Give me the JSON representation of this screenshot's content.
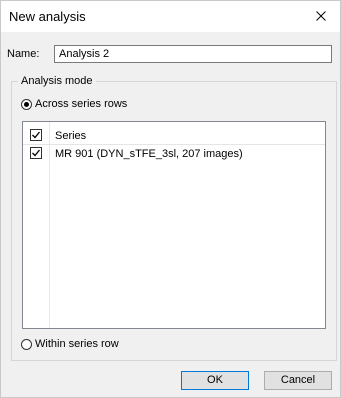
{
  "window": {
    "title": "New analysis"
  },
  "name_field": {
    "label": "Name:",
    "value": "Analysis 2"
  },
  "analysis_mode": {
    "legend": "Analysis mode",
    "options": [
      {
        "label": "Across series rows",
        "selected": true
      },
      {
        "label": "Within series row",
        "selected": false
      }
    ]
  },
  "series_list": {
    "header": {
      "label": "Series",
      "checked": true
    },
    "items": [
      {
        "label": "MR 901 (DYN_sTFE_3sl, 207 images)",
        "checked": true
      }
    ]
  },
  "buttons": {
    "ok": "OK",
    "cancel": "Cancel"
  },
  "icons": {
    "close": "close-icon",
    "check": "check-icon"
  },
  "colors": {
    "default_button_border": "#0078d7",
    "content_bg": "#f0f0f0"
  }
}
